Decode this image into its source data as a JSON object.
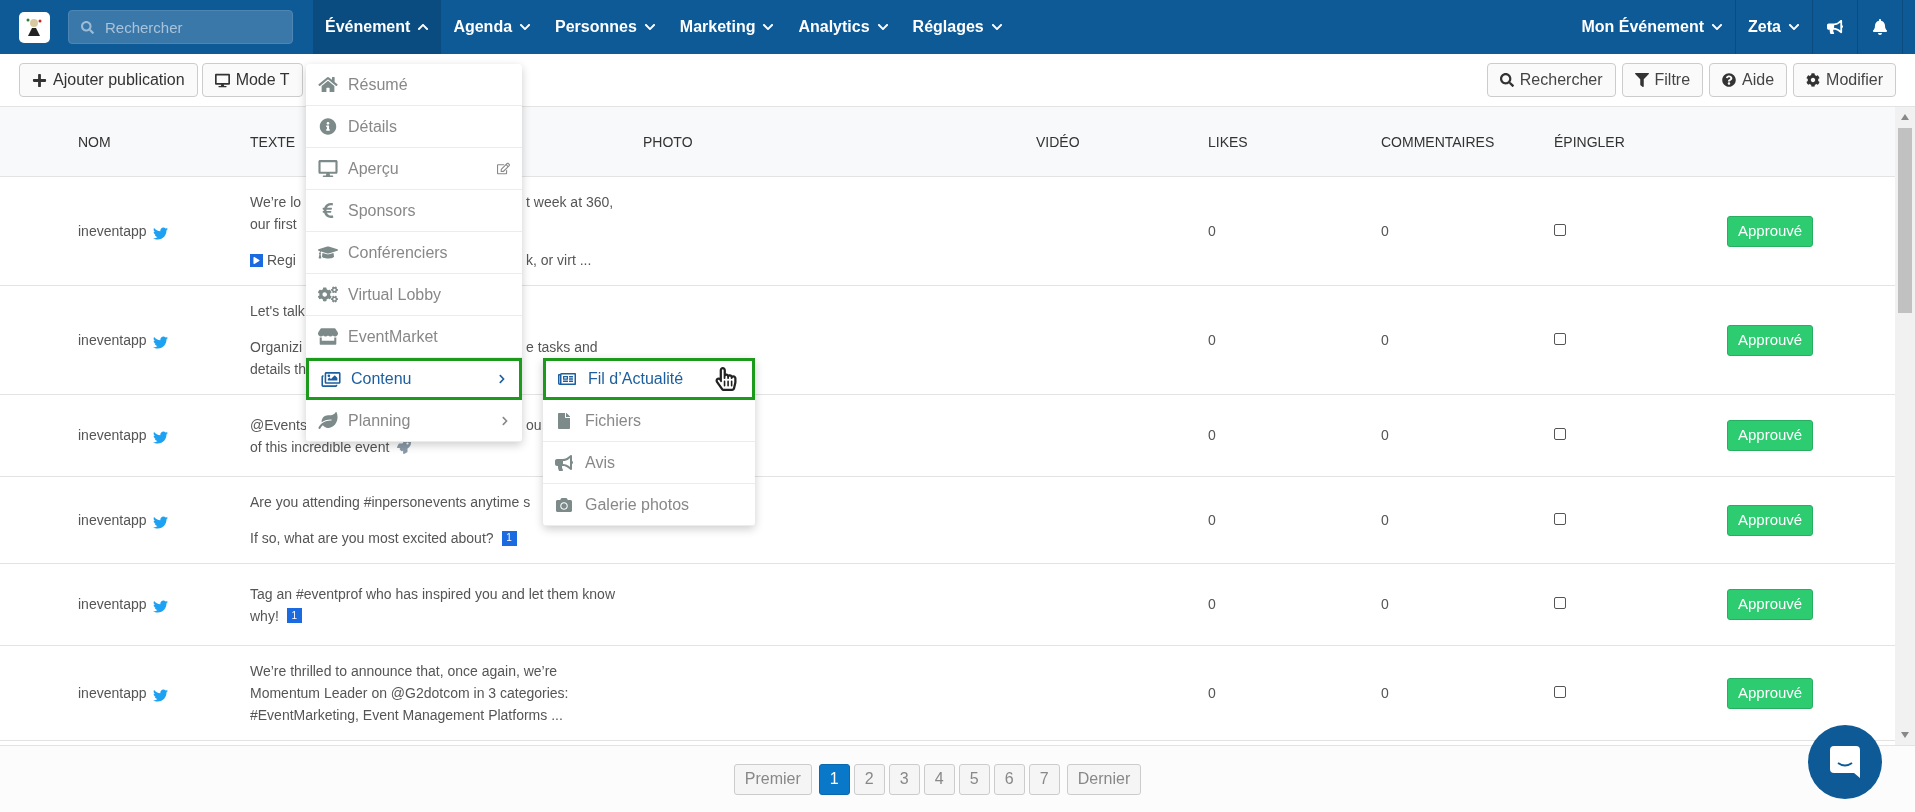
{
  "nav": {
    "search_placeholder": "Rechercher",
    "items": [
      {
        "label": "Événement",
        "selected": true
      },
      {
        "label": "Agenda",
        "selected": false
      },
      {
        "label": "Personnes",
        "selected": false
      },
      {
        "label": "Marketing",
        "selected": false
      },
      {
        "label": "Analytics",
        "selected": false
      },
      {
        "label": "Réglages",
        "selected": false
      }
    ],
    "right": [
      "Mon Événement",
      "Zeta"
    ]
  },
  "toolbar": {
    "left": [
      {
        "kind": "add",
        "label": "Ajouter publication"
      },
      {
        "kind": "screen",
        "label": "Mode T"
      }
    ],
    "right": [
      {
        "kind": "search",
        "label": "Rechercher"
      },
      {
        "kind": "filter",
        "label": "Filtre"
      },
      {
        "kind": "help",
        "label": "Aide"
      },
      {
        "kind": "settings",
        "label": "Modifier"
      }
    ]
  },
  "table": {
    "columns": [
      "NOM",
      "TEXTE",
      "PHOTO",
      "VIDÉO",
      "LIKES",
      "COMMENTAIRES",
      "ÉPINGLER"
    ],
    "rows": [
      {
        "name": "ineventapp",
        "paragraphs": [
          [
            {
              "kind": "plain",
              "text": "We’re lo",
              "after": "t week at 360,"
            },
            {
              "kind": "plain",
              "text": "our first"
            }
          ],
          [
            {
              "kind": "play",
              "text": "Regi",
              "after": "k, or virt ..."
            }
          ]
        ],
        "likes": "0",
        "comments": "0",
        "pinned": false,
        "status": "Approuvé"
      },
      {
        "name": "ineventapp",
        "paragraphs": [
          [
            {
              "kind": "plain",
              "text": "Let's talk"
            }
          ],
          [
            {
              "kind": "plain",
              "text": "Organizi",
              "after": "e tasks and"
            },
            {
              "kind": "plain",
              "text": "details th"
            }
          ]
        ],
        "likes": "0",
        "comments": "0",
        "pinned": false,
        "status": "Approuvé"
      },
      {
        "name": "ineventapp",
        "paragraphs": [
          [
            {
              "kind": "plain",
              "text": "@Events",
              "after": "ou"
            },
            {
              "kind": "rocket",
              "text": "of this incredible event"
            }
          ]
        ],
        "likes": "0",
        "comments": "0",
        "pinned": false,
        "status": "Approuvé"
      },
      {
        "name": "ineventapp",
        "paragraphs": [
          [
            {
              "kind": "plain",
              "text": "Are you attending #inpersonevents anytime s"
            }
          ],
          [
            {
              "kind": "keycap",
              "text": "If so, what are you most excited about?",
              "keycap": "1"
            }
          ]
        ],
        "likes": "0",
        "comments": "0",
        "pinned": false,
        "status": "Approuvé"
      },
      {
        "name": "ineventapp",
        "paragraphs": [
          [
            {
              "kind": "plain",
              "text": "Tag an #eventprof who has inspired you and let them know"
            },
            {
              "kind": "keycap",
              "text": "why!",
              "keycap": "1"
            }
          ]
        ],
        "likes": "0",
        "comments": "0",
        "pinned": false,
        "status": "Approuvé"
      },
      {
        "name": "ineventapp",
        "paragraphs": [
          [
            {
              "kind": "plain",
              "text": "We’re thrilled to announce that, once again, we’re"
            },
            {
              "kind": "plain",
              "text": "Momentum Leader on @G2dotcom in 3 categories:"
            },
            {
              "kind": "plain",
              "text": "#EventMarketing, Event Management Platforms ..."
            }
          ]
        ],
        "likes": "0",
        "comments": "0",
        "pinned": false,
        "status": "Approuvé"
      }
    ]
  },
  "menu": {
    "items": [
      {
        "label": "Résumé",
        "selected": false
      },
      {
        "label": "Détails",
        "selected": false
      },
      {
        "label": "Aperçu",
        "selected": false,
        "external": true
      },
      {
        "label": "Sponsors",
        "selected": false
      },
      {
        "label": "Conférenciers",
        "selected": false
      },
      {
        "label": "Virtual Lobby",
        "selected": false
      },
      {
        "label": "EventMarket",
        "selected": false
      },
      {
        "label": "Contenu",
        "selected": true,
        "submenu": true
      },
      {
        "label": "Planning",
        "selected": false,
        "submenu": true
      }
    ]
  },
  "submenu": {
    "items": [
      {
        "label": "Fil d’Actualité",
        "selected": true
      },
      {
        "label": "Fichiers",
        "selected": false
      },
      {
        "label": "Avis",
        "selected": false
      },
      {
        "label": "Galerie photos",
        "selected": false
      }
    ]
  },
  "pagination": [
    {
      "kind": "edge",
      "label": "Premier",
      "selected": false
    },
    {
      "kind": "page",
      "label": "1",
      "selected": true
    },
    {
      "kind": "page",
      "label": "2",
      "selected": false
    },
    {
      "kind": "page",
      "label": "3",
      "selected": false
    },
    {
      "kind": "page",
      "label": "4",
      "selected": false
    },
    {
      "kind": "page",
      "label": "5",
      "selected": false
    },
    {
      "kind": "page",
      "label": "6",
      "selected": false
    },
    {
      "kind": "page",
      "label": "7",
      "selected": false
    },
    {
      "kind": "edge",
      "label": "Dernier",
      "selected": false
    }
  ]
}
